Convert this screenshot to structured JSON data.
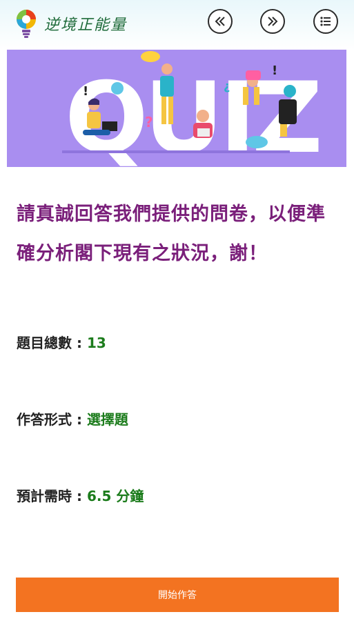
{
  "header": {
    "app_title": "逆境正能量",
    "prev_icon": "double-chevron-left-icon",
    "next_icon": "double-chevron-right-icon",
    "menu_icon": "list-menu-icon"
  },
  "banner": {
    "text": "QUIZ",
    "background_color": "#a98ef0"
  },
  "intro": {
    "message": "請真誠回答我們提供的問卷，以便準確分析閣下現有之狀況，謝！"
  },
  "info": {
    "count_label": "題目總數 : ",
    "count_value": "13",
    "format_label": "作答形式 : ",
    "format_value": "選擇題",
    "time_label": "預計需時 : ",
    "time_value": "6.5 分鐘"
  },
  "actions": {
    "start_label": "開始作答",
    "start_color": "#f37321"
  }
}
